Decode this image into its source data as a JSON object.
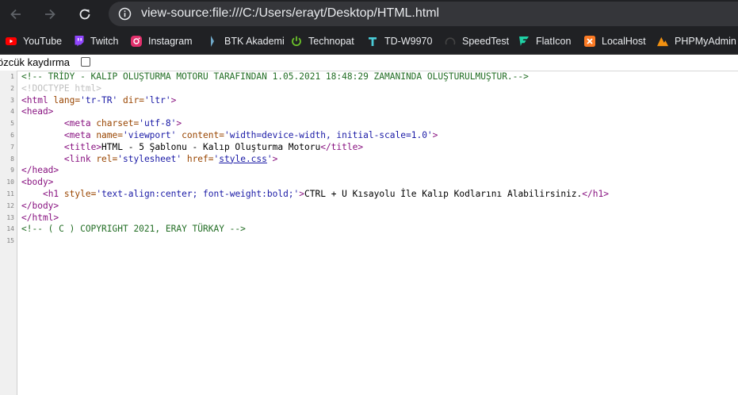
{
  "browser": {
    "url": "view-source:file:///C:/Users/erayt/Desktop/HTML.html",
    "icons": {
      "back": "back-arrow-icon",
      "forward": "forward-arrow-icon",
      "reload": "reload-icon",
      "info": "info-icon"
    },
    "bookmarks": [
      {
        "label": "YouTube",
        "icon": "youtube-icon",
        "color": "#ff0000"
      },
      {
        "label": "Twitch",
        "icon": "twitch-icon",
        "color": "#9146ff"
      },
      {
        "label": "Instagram",
        "icon": "instagram-icon",
        "color": "#e1306c"
      },
      {
        "label": "BTK Akademi",
        "icon": "btk-icon",
        "color": "#6fa8c8"
      },
      {
        "label": "Technopat",
        "icon": "power-icon",
        "color": "#6bc22a"
      },
      {
        "label": "TD-W9970",
        "icon": "tplink-icon",
        "color": "#4acbd6"
      },
      {
        "label": "SpeedTest",
        "icon": "speedtest-icon",
        "color": "#2b2b2b"
      },
      {
        "label": "FlatIcon",
        "icon": "flaticon-icon",
        "color": "#1fd1a5"
      },
      {
        "label": "LocalHost",
        "icon": "xampp-icon",
        "color": "#fb7a24"
      },
      {
        "label": "PHPMyAdmin",
        "icon": "phpmyadmin-icon",
        "color": "#f29111"
      }
    ]
  },
  "source_view": {
    "line_wrap_label": "özcük kaydırma",
    "line_wrap_checked": false,
    "lines": [
      {
        "n": "1",
        "segs": [
          {
            "c": "cm",
            "t": "<!-- TRİDY - KALIP OLUŞTURMA MOTORU TARAFINDAN 1.05.2021 18:48:29 ZAMANINDA OLUŞTURULMUŞTUR.-->"
          }
        ]
      },
      {
        "n": "2",
        "segs": [
          {
            "c": "dt",
            "t": "<!DOCTYPE html>"
          }
        ]
      },
      {
        "n": "3",
        "segs": [
          {
            "c": "tag",
            "t": "<html "
          },
          {
            "c": "an",
            "t": "lang="
          },
          {
            "c": "av",
            "t": "'tr-TR'"
          },
          {
            "c": "an",
            "t": " dir="
          },
          {
            "c": "av",
            "t": "'ltr'"
          },
          {
            "c": "tag",
            "t": ">"
          }
        ]
      },
      {
        "n": "4",
        "segs": [
          {
            "c": "tag",
            "t": "<head>"
          }
        ]
      },
      {
        "n": "5",
        "segs": [
          {
            "c": "",
            "t": "        "
          },
          {
            "c": "tag",
            "t": "<meta "
          },
          {
            "c": "an",
            "t": "charset="
          },
          {
            "c": "av",
            "t": "'utf-8'"
          },
          {
            "c": "tag",
            "t": ">"
          }
        ]
      },
      {
        "n": "6",
        "segs": [
          {
            "c": "",
            "t": "        "
          },
          {
            "c": "tag",
            "t": "<meta "
          },
          {
            "c": "an",
            "t": "name="
          },
          {
            "c": "av",
            "t": "'viewport'"
          },
          {
            "c": "an",
            "t": " content="
          },
          {
            "c": "av",
            "t": "'width=device-width, initial-scale=1.0'"
          },
          {
            "c": "tag",
            "t": ">"
          }
        ]
      },
      {
        "n": "7",
        "segs": [
          {
            "c": "",
            "t": "        "
          },
          {
            "c": "tag",
            "t": "<title>"
          },
          {
            "c": "",
            "t": "HTML - 5 Şablonu - Kalıp Oluşturma Motoru"
          },
          {
            "c": "tag",
            "t": "</title>"
          }
        ]
      },
      {
        "n": "8",
        "segs": [
          {
            "c": "",
            "t": "        "
          },
          {
            "c": "tag",
            "t": "<link "
          },
          {
            "c": "an",
            "t": "rel="
          },
          {
            "c": "av",
            "t": "'stylesheet'"
          },
          {
            "c": "an",
            "t": " href="
          },
          {
            "c": "av",
            "t": "'"
          },
          {
            "c": "lk",
            "t": "style.css"
          },
          {
            "c": "av",
            "t": "'"
          },
          {
            "c": "tag",
            "t": ">"
          }
        ]
      },
      {
        "n": "9",
        "segs": [
          {
            "c": "tag",
            "t": "</head>"
          }
        ]
      },
      {
        "n": "10",
        "segs": [
          {
            "c": "tag",
            "t": "<body>"
          }
        ]
      },
      {
        "n": "11",
        "segs": [
          {
            "c": "",
            "t": "    "
          },
          {
            "c": "tag",
            "t": "<h1 "
          },
          {
            "c": "an",
            "t": "style="
          },
          {
            "c": "av",
            "t": "'text-align:center; font-weight:bold;'"
          },
          {
            "c": "tag",
            "t": ">"
          },
          {
            "c": "",
            "t": "CTRL + U Kısayolu İle Kalıp Kodlarını Alabilirsiniz."
          },
          {
            "c": "tag",
            "t": "</h1>"
          }
        ]
      },
      {
        "n": "12",
        "segs": [
          {
            "c": "tag",
            "t": "</body>"
          }
        ]
      },
      {
        "n": "13",
        "segs": [
          {
            "c": "tag",
            "t": "</html>"
          }
        ]
      },
      {
        "n": "14",
        "segs": [
          {
            "c": "cm",
            "t": "<!-- ( C ) COPYRIGHT 2021, ERAY TÜRKAY -->"
          }
        ]
      },
      {
        "n": "15",
        "segs": []
      }
    ]
  }
}
